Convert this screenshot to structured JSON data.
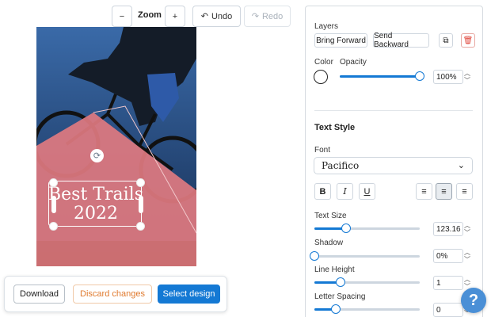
{
  "toolbar": {
    "zoom_out": "−",
    "zoom_label": "Zoom",
    "zoom_in": "+",
    "undo_icon": "↶",
    "undo": "Undo",
    "redo_icon": "↷",
    "redo": "Redo"
  },
  "canvas": {
    "title_line1": "Best Trails",
    "title_line2": "2022",
    "rotate_icon": "⟳",
    "colors": {
      "sky": "#2a4f86",
      "shape": "#e07a80",
      "ground": "#c86a6a"
    }
  },
  "actions": {
    "download": "Download",
    "discard": "Discard changes",
    "select": "Select design"
  },
  "panel": {
    "layers_label": "Layers",
    "bring_forward": "Bring Forward",
    "send_backward": "Send Backward",
    "duplicate_icon": "⧉",
    "delete_icon": "🗑",
    "color_label": "Color",
    "opacity_label": "Opacity",
    "opacity_value": "100%",
    "opacity_level": 100,
    "text_style_heading": "Text Style",
    "font_label": "Font",
    "font_value": "Pacifico",
    "font_chevron": "⌄",
    "bold": "B",
    "italic": "I",
    "underline": "U",
    "align_left_icon": "≡",
    "align_center_icon": "≡",
    "align_right_icon": "≡",
    "text_size_label": "Text Size",
    "text_size_value": "123.16",
    "text_size_level": 30,
    "shadow_label": "Shadow",
    "shadow_value": "0%",
    "shadow_level": 0,
    "line_height_label": "Line Height",
    "line_height_value": "1",
    "line_height_level": 25,
    "letter_spacing_label": "Letter Spacing",
    "letter_spacing_value": "0",
    "letter_spacing_level": 20,
    "stepper_up": "︿",
    "stepper_down": "﹀"
  },
  "help": {
    "label": "?"
  },
  "colors": {
    "accent": "#1479d4",
    "discard": "#e07a2e",
    "delete": "#e0453a"
  }
}
